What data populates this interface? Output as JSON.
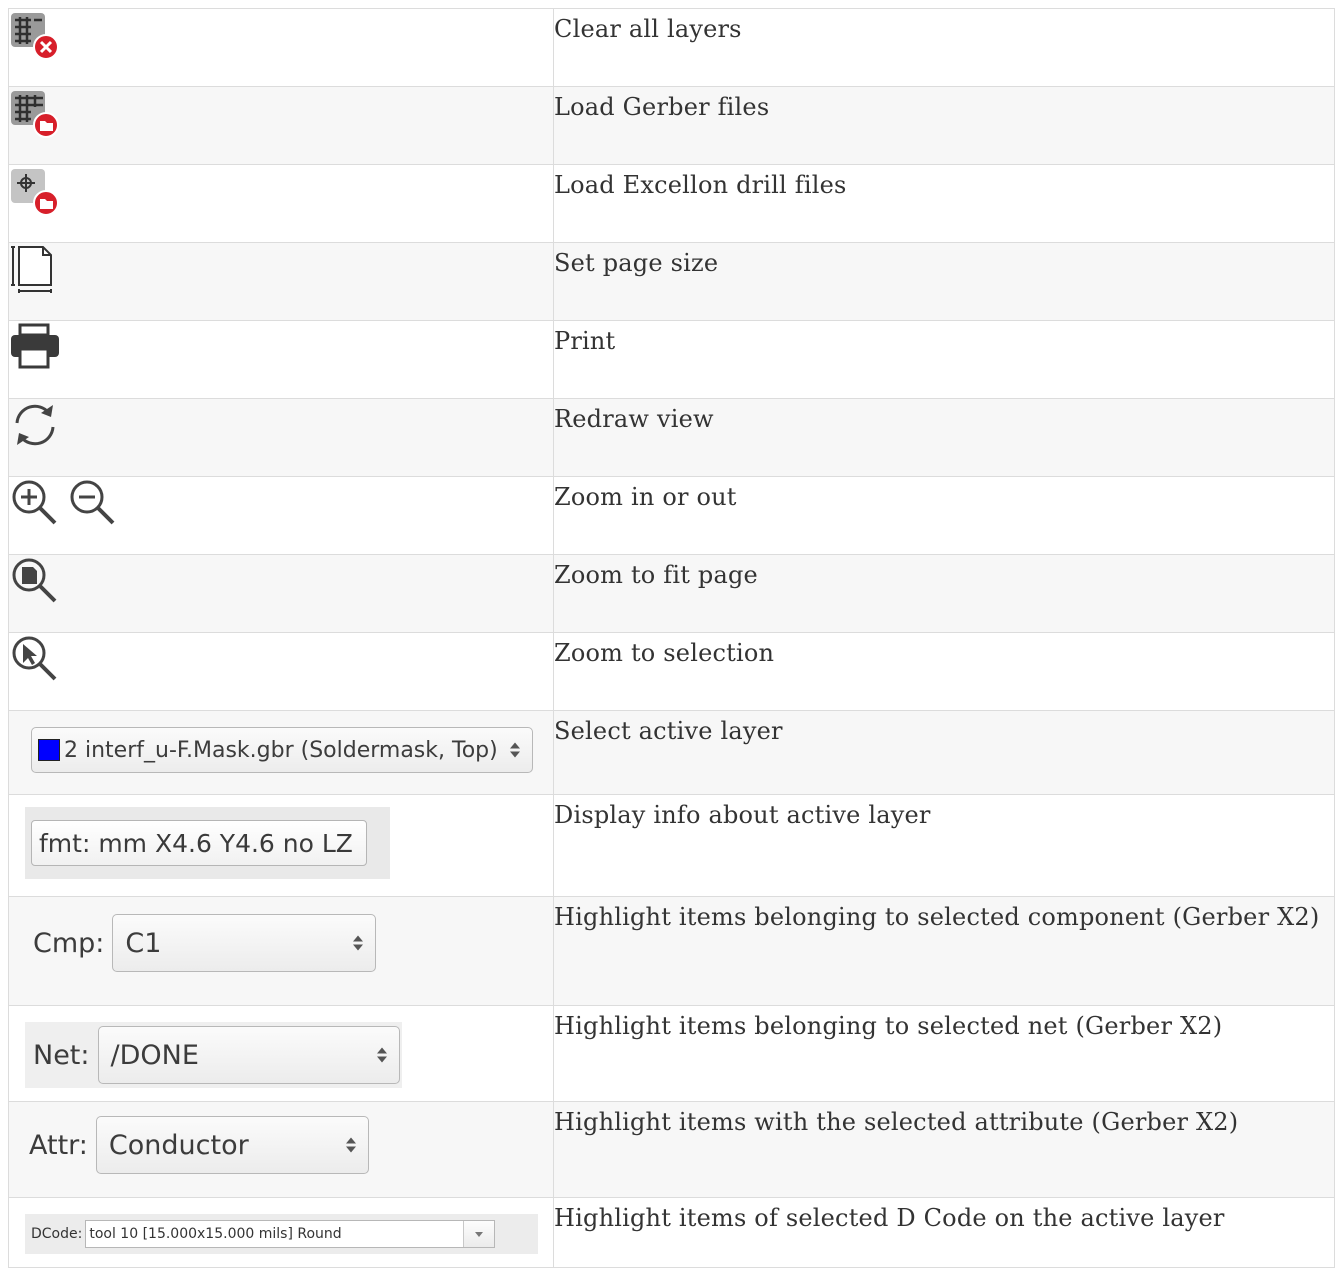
{
  "rows": [
    {
      "icon": "clear-layers-icon",
      "desc": "Clear all layers"
    },
    {
      "icon": "load-gerber-icon",
      "desc": "Load Gerber files"
    },
    {
      "icon": "load-drill-icon",
      "desc": "Load Excellon drill files"
    },
    {
      "icon": "page-size-icon",
      "desc": "Set page size"
    },
    {
      "icon": "printer-icon",
      "desc": "Print"
    },
    {
      "icon": "refresh-icon",
      "desc": "Redraw view"
    },
    {
      "icon": "zoom-in-out-icon",
      "desc": "Zoom in or out"
    },
    {
      "icon": "zoom-fit-page-icon",
      "desc": "Zoom to fit page"
    },
    {
      "icon": "zoom-selection-icon",
      "desc": "Zoom to selection"
    },
    {
      "icon": "layer-select",
      "desc": "Select active layer"
    },
    {
      "icon": "layer-info",
      "desc": "Display info about active layer"
    },
    {
      "icon": "component-select",
      "desc": "Highlight items belonging to selected component (Gerber X2)"
    },
    {
      "icon": "net-select",
      "desc": "Highlight items belonging to selected net (Gerber X2)"
    },
    {
      "icon": "attribute-select",
      "desc": "Highlight items with the selected attribute (Gerber X2)"
    },
    {
      "icon": "dcode-select",
      "desc": "Highlight items of selected D Code on the active layer"
    }
  ],
  "widgets": {
    "layer_value": "2 interf_u-F.Mask.gbr (Soldermask, Top)",
    "layer_swatch_color": "#0000ff",
    "fmt_value": "fmt: mm X4.6 Y4.6 no LZ",
    "cmp_label": "Cmp:",
    "cmp_value": "C1",
    "net_label": "Net:",
    "net_value": "/DONE",
    "attr_label": "Attr:",
    "attr_value": "Conductor",
    "dcode_label": "DCode:",
    "dcode_value": "tool 10 [15.000x15.000 mils] Round"
  },
  "colors": {
    "accent_red": "#d71f2a",
    "icon_gray": "#8f8f8f"
  }
}
